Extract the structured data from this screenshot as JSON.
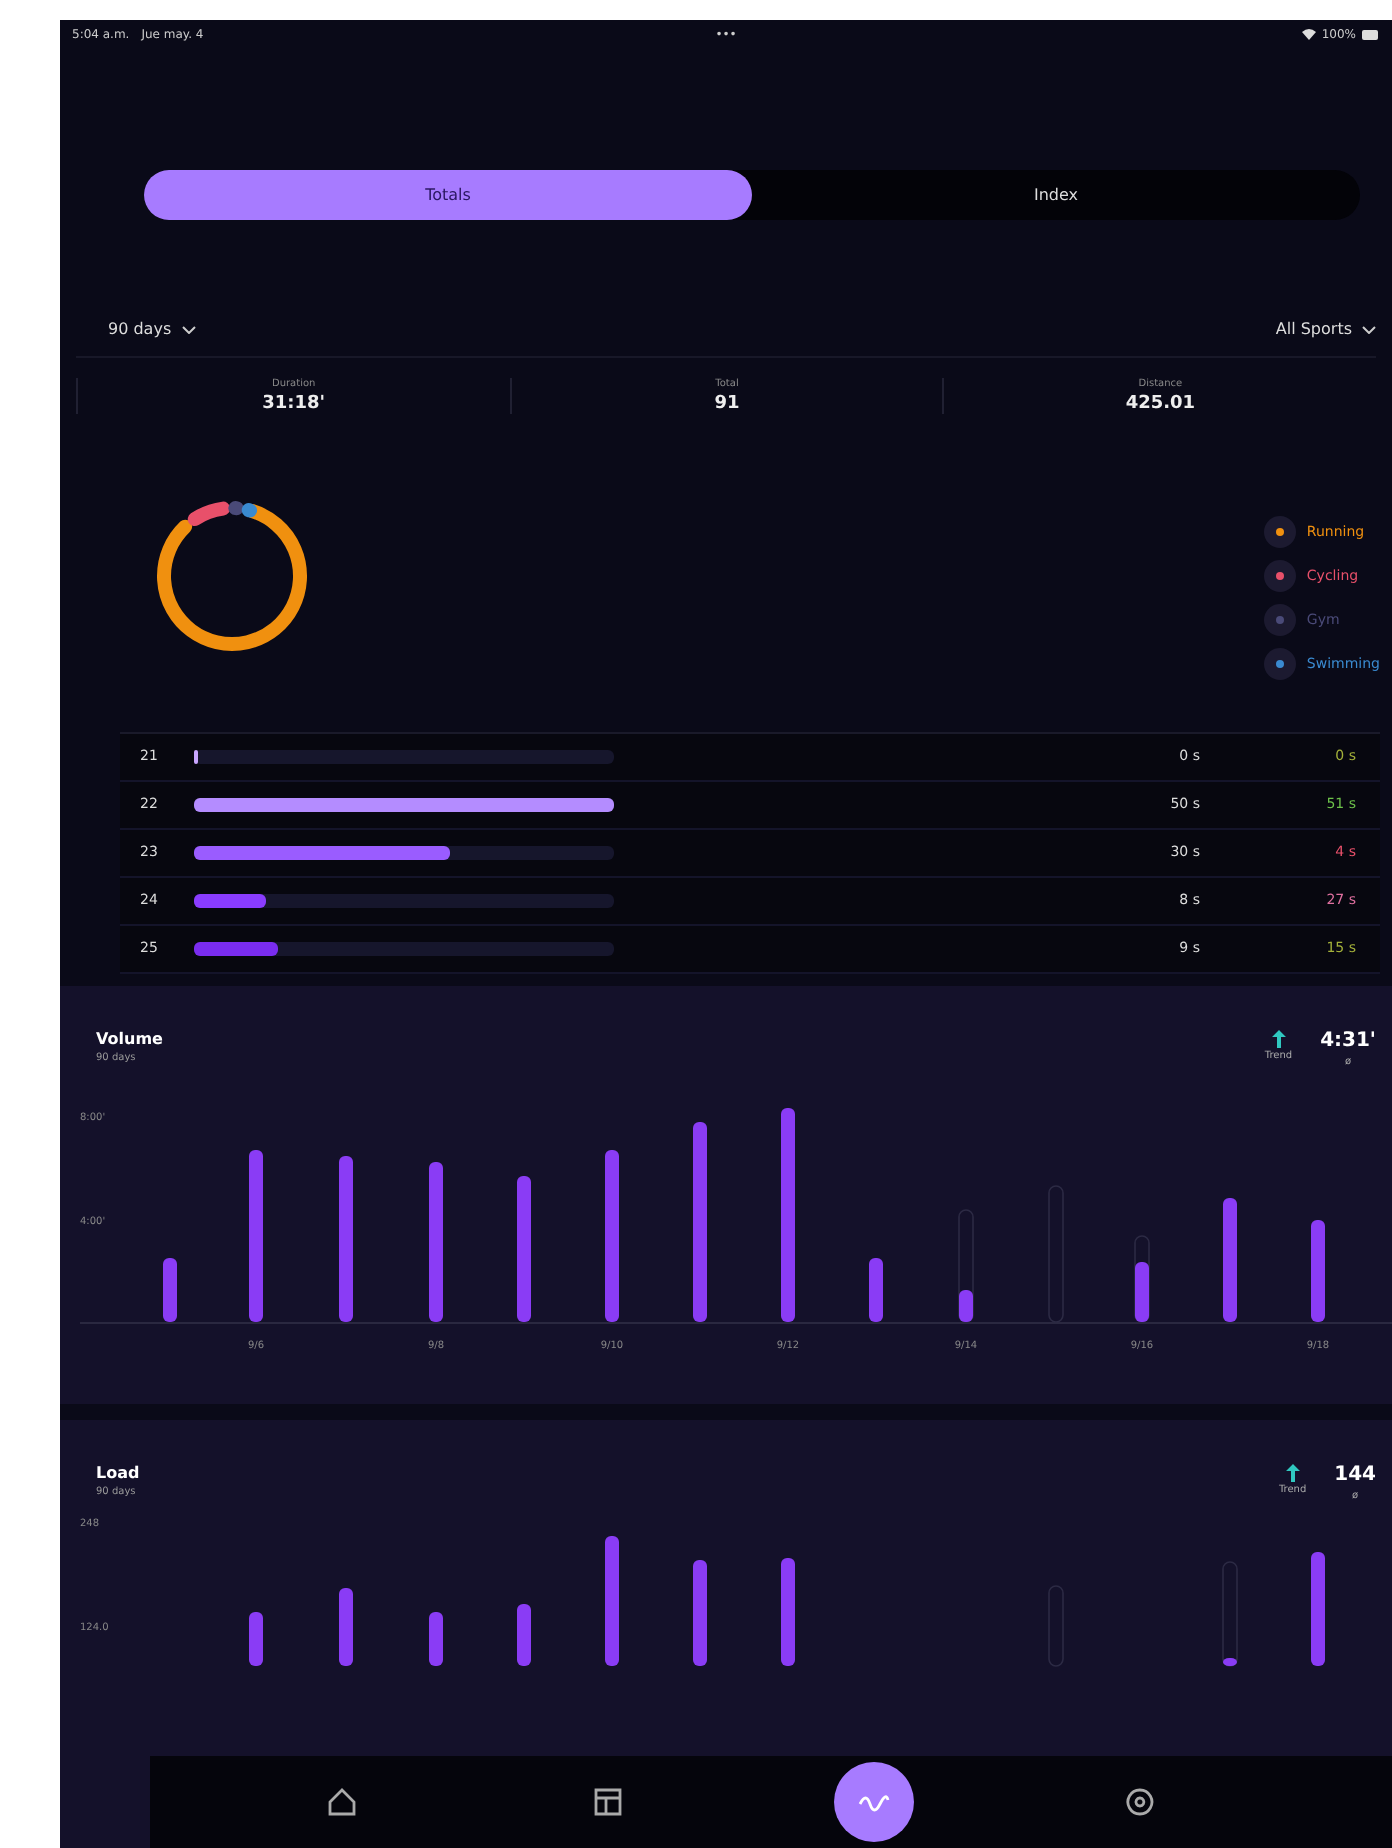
{
  "status_bar": {
    "time": "5:04 a.m.",
    "date": "Jue may. 4",
    "dots": "•••",
    "battery": "100%"
  },
  "tabs": [
    {
      "label": "Totals",
      "selected": true
    },
    {
      "label": "Index",
      "selected": false
    }
  ],
  "filters": {
    "period": "90 days",
    "sport": "All Sports"
  },
  "stats": [
    {
      "label": "Duration",
      "value": "31:18'"
    },
    {
      "label": "Total",
      "value": "91"
    },
    {
      "label": "Distance",
      "value": "425.01"
    }
  ],
  "sports": [
    {
      "name": "Running",
      "color": "#f0900f"
    },
    {
      "name": "Cycling",
      "color": "#e8506a"
    },
    {
      "name": "Gym",
      "color": "#4a4a78"
    },
    {
      "name": "Swimming",
      "color": "#3a8ad0"
    }
  ],
  "zones": [
    {
      "label": "21",
      "level": 0.01,
      "value": "0 s",
      "change": "0 s",
      "color": "#a3b03a"
    },
    {
      "label": "22",
      "level": 1.0,
      "value": "50 s",
      "change": "51 s",
      "color": "#6cc04a"
    },
    {
      "label": "23",
      "level": 0.61,
      "value": "30 s",
      "change": "4 s",
      "color": "#e8506a"
    },
    {
      "label": "24",
      "level": 0.17,
      "value": "8 s",
      "change": "27 s",
      "color": "#e070a0"
    },
    {
      "label": "25",
      "level": 0.2,
      "value": "9 s",
      "change": "15 s",
      "color": "#a3b03a"
    }
  ],
  "charts": [
    {
      "kind": "volume",
      "title": "Volume",
      "subtitle": "90 days",
      "trend": "Trend",
      "value": "4:31'",
      "unit": "ø",
      "y_labels": [
        "8:00'",
        "4:00'"
      ],
      "x_labels": [
        "9/6",
        "9/8",
        "9/10",
        "9/12",
        "9/14",
        "9/16",
        "9/18"
      ]
    },
    {
      "kind": "load",
      "title": "Load",
      "subtitle": "90 days",
      "trend": "Trend",
      "value": "144",
      "unit": "ø",
      "y_labels": [
        "248",
        "124.0"
      ]
    }
  ],
  "nav": [
    {
      "kind": "home",
      "selected": false
    },
    {
      "kind": "calendar",
      "selected": false
    },
    {
      "kind": "activity",
      "selected": true
    },
    {
      "kind": "settings",
      "selected": false
    }
  ]
}
